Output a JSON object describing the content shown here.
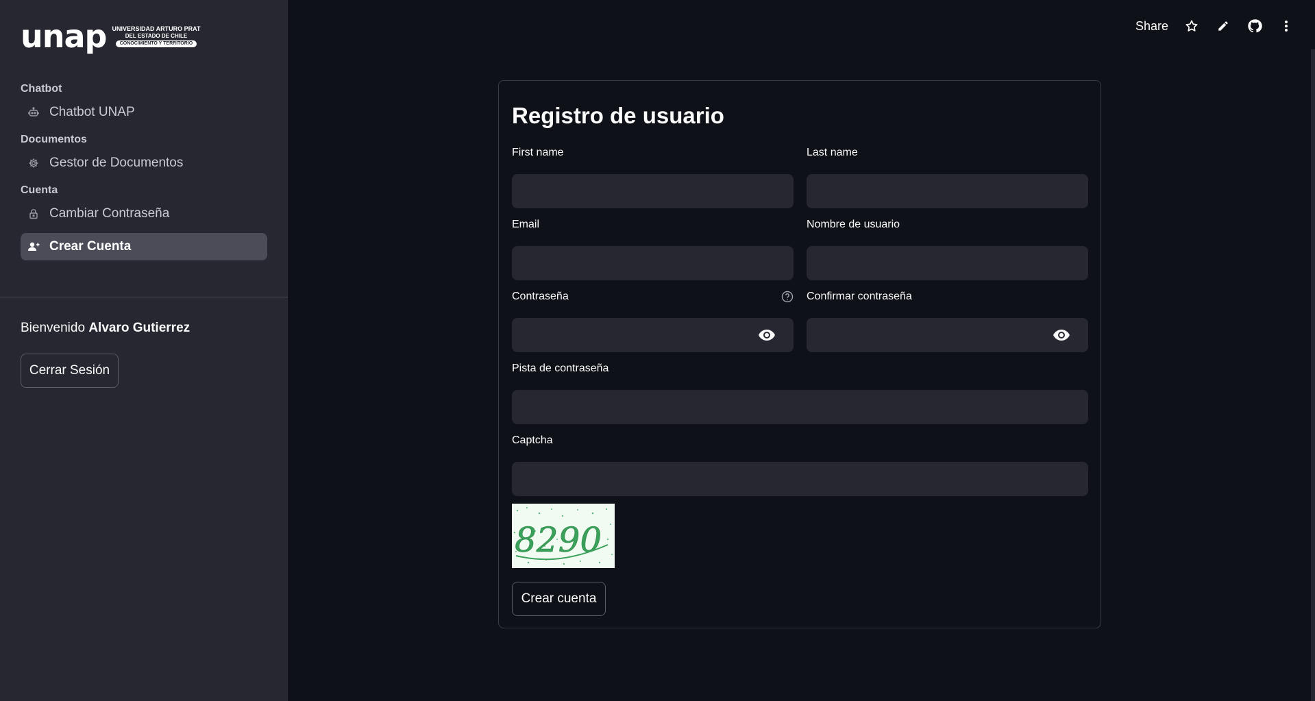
{
  "sidebar": {
    "logo": {
      "word": "unap",
      "line1": "UNIVERSIDAD ARTURO PRAT",
      "line2": "DEL ESTADO DE CHILE",
      "line3": "CONOCIMIENTO Y TERRITORIO"
    },
    "sections": [
      {
        "title": "Chatbot",
        "items": [
          {
            "label": "Chatbot UNAP",
            "icon": "robot-icon"
          }
        ]
      },
      {
        "title": "Documentos",
        "items": [
          {
            "label": "Gestor de Documentos",
            "icon": "gear-icon"
          }
        ]
      },
      {
        "title": "Cuenta",
        "items": [
          {
            "label": "Cambiar Contraseña",
            "icon": "lock-icon"
          },
          {
            "label": "Crear Cuenta",
            "icon": "add-user-icon",
            "active": true
          }
        ]
      }
    ],
    "welcome_prefix": "Bienvenido",
    "welcome_name": "Alvaro Gutierrez",
    "logout_label": "Cerrar Sesión"
  },
  "topbar": {
    "share_label": "Share",
    "icons": [
      "star-icon",
      "pencil-icon",
      "github-icon",
      "more-vert-icon"
    ]
  },
  "form": {
    "title": "Registro de usuario",
    "first_name_label": "First name",
    "first_name_value": "",
    "last_name_label": "Last name",
    "last_name_value": "",
    "email_label": "Email",
    "email_value": "",
    "username_label": "Nombre de usuario",
    "username_value": "",
    "password_label": "Contraseña",
    "password_value": "",
    "confirm_password_label": "Confirmar contraseña",
    "confirm_password_value": "",
    "hint_label": "Pista de contraseña",
    "hint_value": "",
    "captcha_label": "Captcha",
    "captcha_value": "",
    "captcha_text": "8290",
    "submit_label": "Crear cuenta"
  },
  "colors": {
    "background": "#0e1117",
    "sidebar": "#262730",
    "input": "#262730",
    "active_nav": "#4b4c57",
    "captcha_ink": "#3aa05a"
  }
}
